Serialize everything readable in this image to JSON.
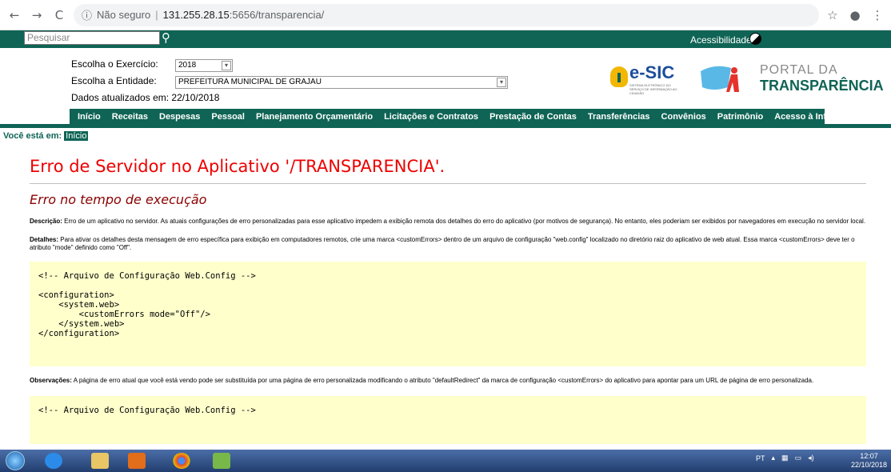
{
  "browser": {
    "security": "Não seguro",
    "host": "131.255.28.15",
    "path": ":5656/transparencia/"
  },
  "topbar": {
    "search_placeholder": "Pesquisar",
    "accessibility_label": "Acessibilidade:"
  },
  "header": {
    "exercise_label": "Escolha o Exercício:",
    "exercise_value": "2018",
    "entity_label": "Escolha a Entidade:",
    "entity_value": "PREFEITURA MUNICIPAL DE GRAJAU",
    "updated_text": "Dados atualizados em: 22/10/2018",
    "esic_logo": "e-SIC",
    "esic_sub": "SISTEMA ELETRÔNICO DO SERVIÇO DE INFORMAÇÃO AO CIDADÃO",
    "portal_line1": "PORTAL DA",
    "portal_line2": "TRANSPARÊNCIA"
  },
  "menu": [
    "Início",
    "Receitas",
    "Despesas",
    "Pessoal",
    "Planejamento Orçamentário",
    "Licitações e Contratos",
    "Prestação de Contas",
    "Transferências",
    "Convênios",
    "Patrimônio",
    "Acesso à Informação"
  ],
  "breadcrumb": {
    "label": "Você está em:",
    "current": "Início"
  },
  "error": {
    "title": "Erro de Servidor no Aplicativo '/TRANSPARENCIA'.",
    "subtitle": "Erro no tempo de execução",
    "desc_label": "Descrição:",
    "desc_text": "Erro de um aplicativo no servidor. As atuais configurações de erro personalizadas para esse aplicativo impedem a exibição remota dos detalhes do erro do aplicativo (por motivos de segurança). No entanto, eles poderiam ser exibidos por navegadores em execução no servidor local.",
    "details_label": "Detalhes:",
    "details_text": "Para ativar os detalhes desta mensagem de erro específica para exibição em computadores remotos, crie uma marca <customErrors> dentro de um arquivo de configuração \"web.config\" localizado no diretório raiz do aplicativo de web atual. Essa marca <customErrors> deve ter o atributo \"mode\" definido como \"Off\".",
    "code1": "<!-- Arquivo de Configuração Web.Config -->\n\n<configuration>\n    <system.web>\n        <customErrors mode=\"Off\"/>\n    </system.web>\n</configuration>",
    "obs_label": "Observações:",
    "obs_text": "A página de erro atual que você está vendo pode ser substituída por uma página de erro personalizada modificando o atributo \"defaultRedirect\" da marca de configuração <customErrors> do aplicativo para apontar para um URL de página de erro personalizada.",
    "code2": "<!-- Arquivo de Configuração Web.Config -->"
  },
  "taskbar": {
    "lang": "PT",
    "time": "12:07",
    "date": "22/10/2018"
  },
  "colors": {
    "brand": "#0f6455",
    "error_title": "#e00000",
    "code_bg": "#ffffcc"
  }
}
